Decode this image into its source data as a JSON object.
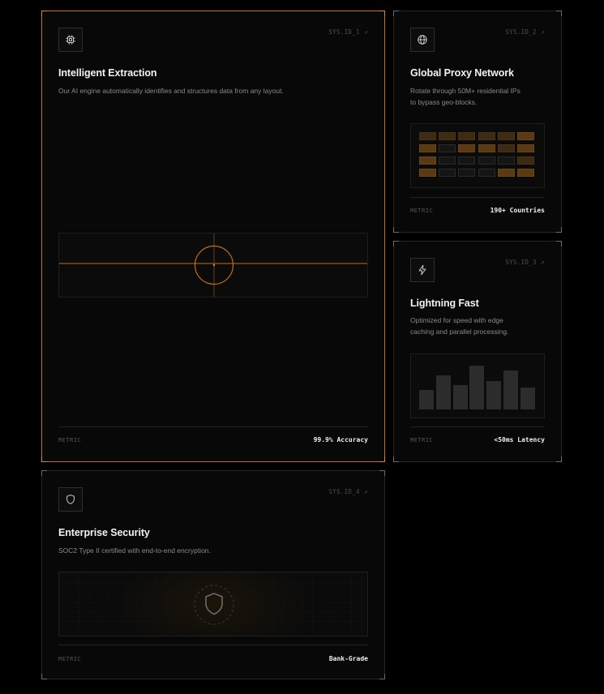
{
  "cards": [
    {
      "id": "extraction",
      "sys_id": "SYS.ID_1",
      "arrow": "↗",
      "title": "Intelligent Extraction",
      "description": "Our AI engine automatically identifies and structures data from any layout.",
      "metric_label": "METRIC",
      "metric_value": "99.9% Accuracy",
      "icon": "cpu-chip-icon"
    },
    {
      "id": "proxy",
      "sys_id": "SYS.ID_2",
      "arrow": "↗",
      "title": "Global Proxy Network",
      "description_line1": "Rotate through 50M+ residential IPs",
      "description_line2": "to bypass geo-blocks.",
      "metric_label": "METRIC",
      "metric_value": "190+ Countries",
      "icon": "globe-icon"
    },
    {
      "id": "speed",
      "sys_id": "SYS.ID_3",
      "arrow": "↗",
      "title": "Lightning Fast",
      "description_line1": "Optimized for speed with edge",
      "description_line2": "caching and parallel processing.",
      "metric_label": "METRIC",
      "metric_value": "<50ms Latency",
      "icon": "lightning-bolt-icon"
    },
    {
      "id": "security",
      "sys_id": "SYS.ID_4",
      "arrow": "↗",
      "title": "Enterprise Security",
      "description": "SOC2 Type II certified with end-to-end encryption.",
      "metric_label": "METRIC",
      "metric_value": "Bank-Grade",
      "icon": "shield-icon"
    }
  ],
  "colors": {
    "accent": "#c0701c",
    "background": "#000000",
    "card": "#080808",
    "border": "#262626"
  },
  "proxy_grid_intensity": [
    [
      1,
      1,
      1,
      1,
      1,
      2
    ],
    [
      2,
      0,
      2,
      2,
      1,
      2
    ],
    [
      2,
      0,
      0,
      0,
      0,
      1
    ],
    [
      2,
      0,
      0,
      0,
      2,
      2
    ]
  ],
  "latency_bars": [
    0.45,
    0.78,
    0.55,
    1.0,
    0.65,
    0.88,
    0.5
  ]
}
